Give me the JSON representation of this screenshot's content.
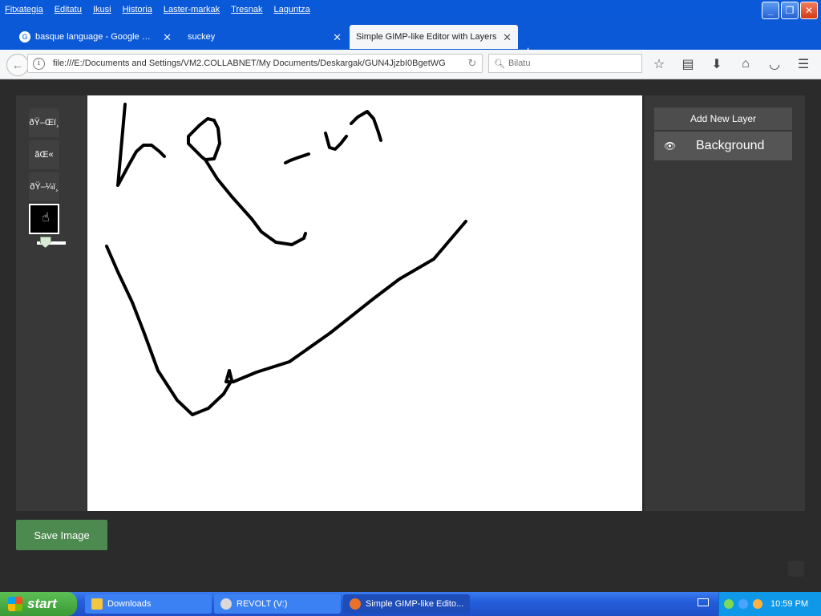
{
  "menubar": {
    "items": [
      "Fitxategia",
      "Editatu",
      "Ikusi",
      "Historia",
      "Laster-markak",
      "Tresnak",
      "Laguntza"
    ]
  },
  "window_controls": {
    "minimize": "_",
    "maximize": "❐",
    "close": "✕"
  },
  "tabs": [
    {
      "label": "basque language - Google Bil...",
      "favicon": "google-icon"
    },
    {
      "label": "suckey"
    },
    {
      "label": "Simple GIMP-like Editor with Layers",
      "active": true
    }
  ],
  "navbar": {
    "url": "file:///E:/Documents and Settings/VM2.COLLABNET/My Documents/Deskargak/GUN4JjzbI0BgetWG",
    "search_placeholder": "Bilatu"
  },
  "toolbar": {
    "tools": [
      {
        "label": "ðŸ–Œï¸"
      },
      {
        "label": "ãŒ«"
      },
      {
        "label": "ðŸ–¼ï¸"
      }
    ],
    "current_color": "#000000",
    "brush_size": 0.15
  },
  "layers": {
    "add_label": "Add New Layer",
    "items": [
      {
        "name": "Background",
        "visible": true
      }
    ]
  },
  "save_label": "Save Image",
  "taskbar": {
    "start_label": "start",
    "items": [
      {
        "label": "Downloads",
        "icon": "folder-icon"
      },
      {
        "label": "REVOLT (V:)",
        "icon": "drive-icon"
      },
      {
        "label": "Simple GIMP-like Edito...",
        "icon": "firefox-icon",
        "active": true
      }
    ],
    "clock": "10:59 PM"
  }
}
